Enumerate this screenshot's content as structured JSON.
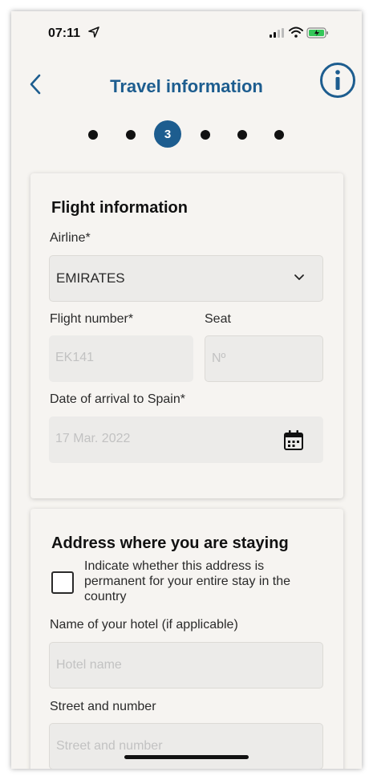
{
  "status_bar": {
    "time": "07:11"
  },
  "header": {
    "title": "Travel information"
  },
  "stepper": {
    "current_step": "3",
    "total_steps": 6
  },
  "flight_section": {
    "title": "Flight information",
    "airline_label": "Airline*",
    "airline_value": "EMIRATES",
    "flight_number_label": "Flight number*",
    "flight_number_value": "EK141",
    "seat_label": "Seat",
    "seat_placeholder": "Nº",
    "arrival_label": "Date of arrival to Spain*",
    "arrival_value": "17 Mar. 2022"
  },
  "address_section": {
    "title": "Address where you are staying",
    "permanent_checkbox_label": "Indicate whether this address is permanent for your entire stay in the country",
    "hotel_label": "Name of your hotel (if applicable)",
    "hotel_placeholder": "Hotel name",
    "street_label": "Street and number",
    "street_placeholder": "Street and number"
  },
  "colors": {
    "accent": "#1d5d8f",
    "background": "#f6f4f1",
    "field": "#ecebe9"
  }
}
